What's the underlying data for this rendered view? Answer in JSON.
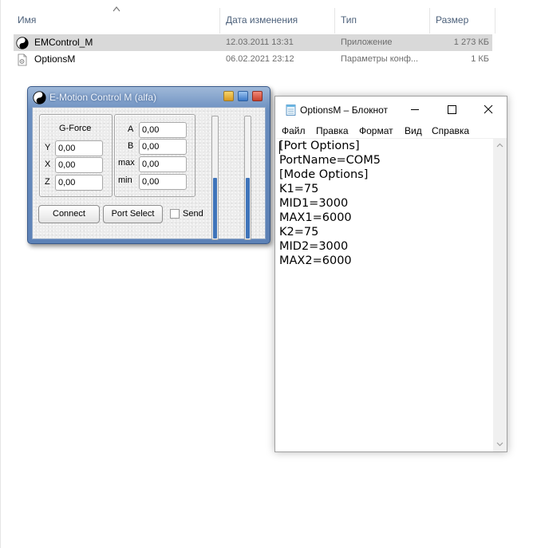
{
  "explorer": {
    "columns": {
      "name": "Имя",
      "date": "Дата изменения",
      "type": "Тип",
      "size": "Размер"
    },
    "files": [
      {
        "name": "EMControl_M",
        "date": "12.03.2011 13:31",
        "type": "Приложение",
        "size": "1 273 КБ",
        "icon": "yin-yang-app-icon",
        "selected": true
      },
      {
        "name": "OptionsM",
        "date": "06.02.2021 23:12",
        "type": "Параметры конф...",
        "size": "1 КБ",
        "icon": "config-file-icon",
        "selected": false
      }
    ]
  },
  "emotion": {
    "title": "E-Motion Control M (alfa)",
    "gforce": {
      "label": "G-Force",
      "y_label": "Y",
      "y_value": "0,00",
      "x_label": "X",
      "x_value": "0,00",
      "z_label": "Z",
      "z_value": "0,00"
    },
    "params": {
      "a_label": "A",
      "a_value": "0,00",
      "b_label": "B",
      "b_value": "0,00",
      "max_label": "max",
      "max_value": "0,00",
      "min_label": "min",
      "min_value": "0,00"
    },
    "connect_label": "Connect",
    "port_select_label": "Port Select",
    "send_label": "Send",
    "send_checked": false,
    "sliders": [
      {
        "name": "left",
        "level": 0.5
      },
      {
        "name": "right",
        "level": 0.5
      }
    ],
    "colors": {
      "title_bar": "#6b8fc0",
      "slider_fill": "#3f74ba"
    }
  },
  "notepad": {
    "title": "OptionsM – Блокнот",
    "menu": [
      "Файл",
      "Правка",
      "Формат",
      "Вид",
      "Справка"
    ],
    "lines": [
      "[Port Options]",
      "PortName=COM5",
      "[Mode Options]",
      "K1=75",
      "MID1=3000",
      "MAX1=6000",
      "K2=75",
      "MID2=3000",
      "MAX2=6000"
    ]
  }
}
